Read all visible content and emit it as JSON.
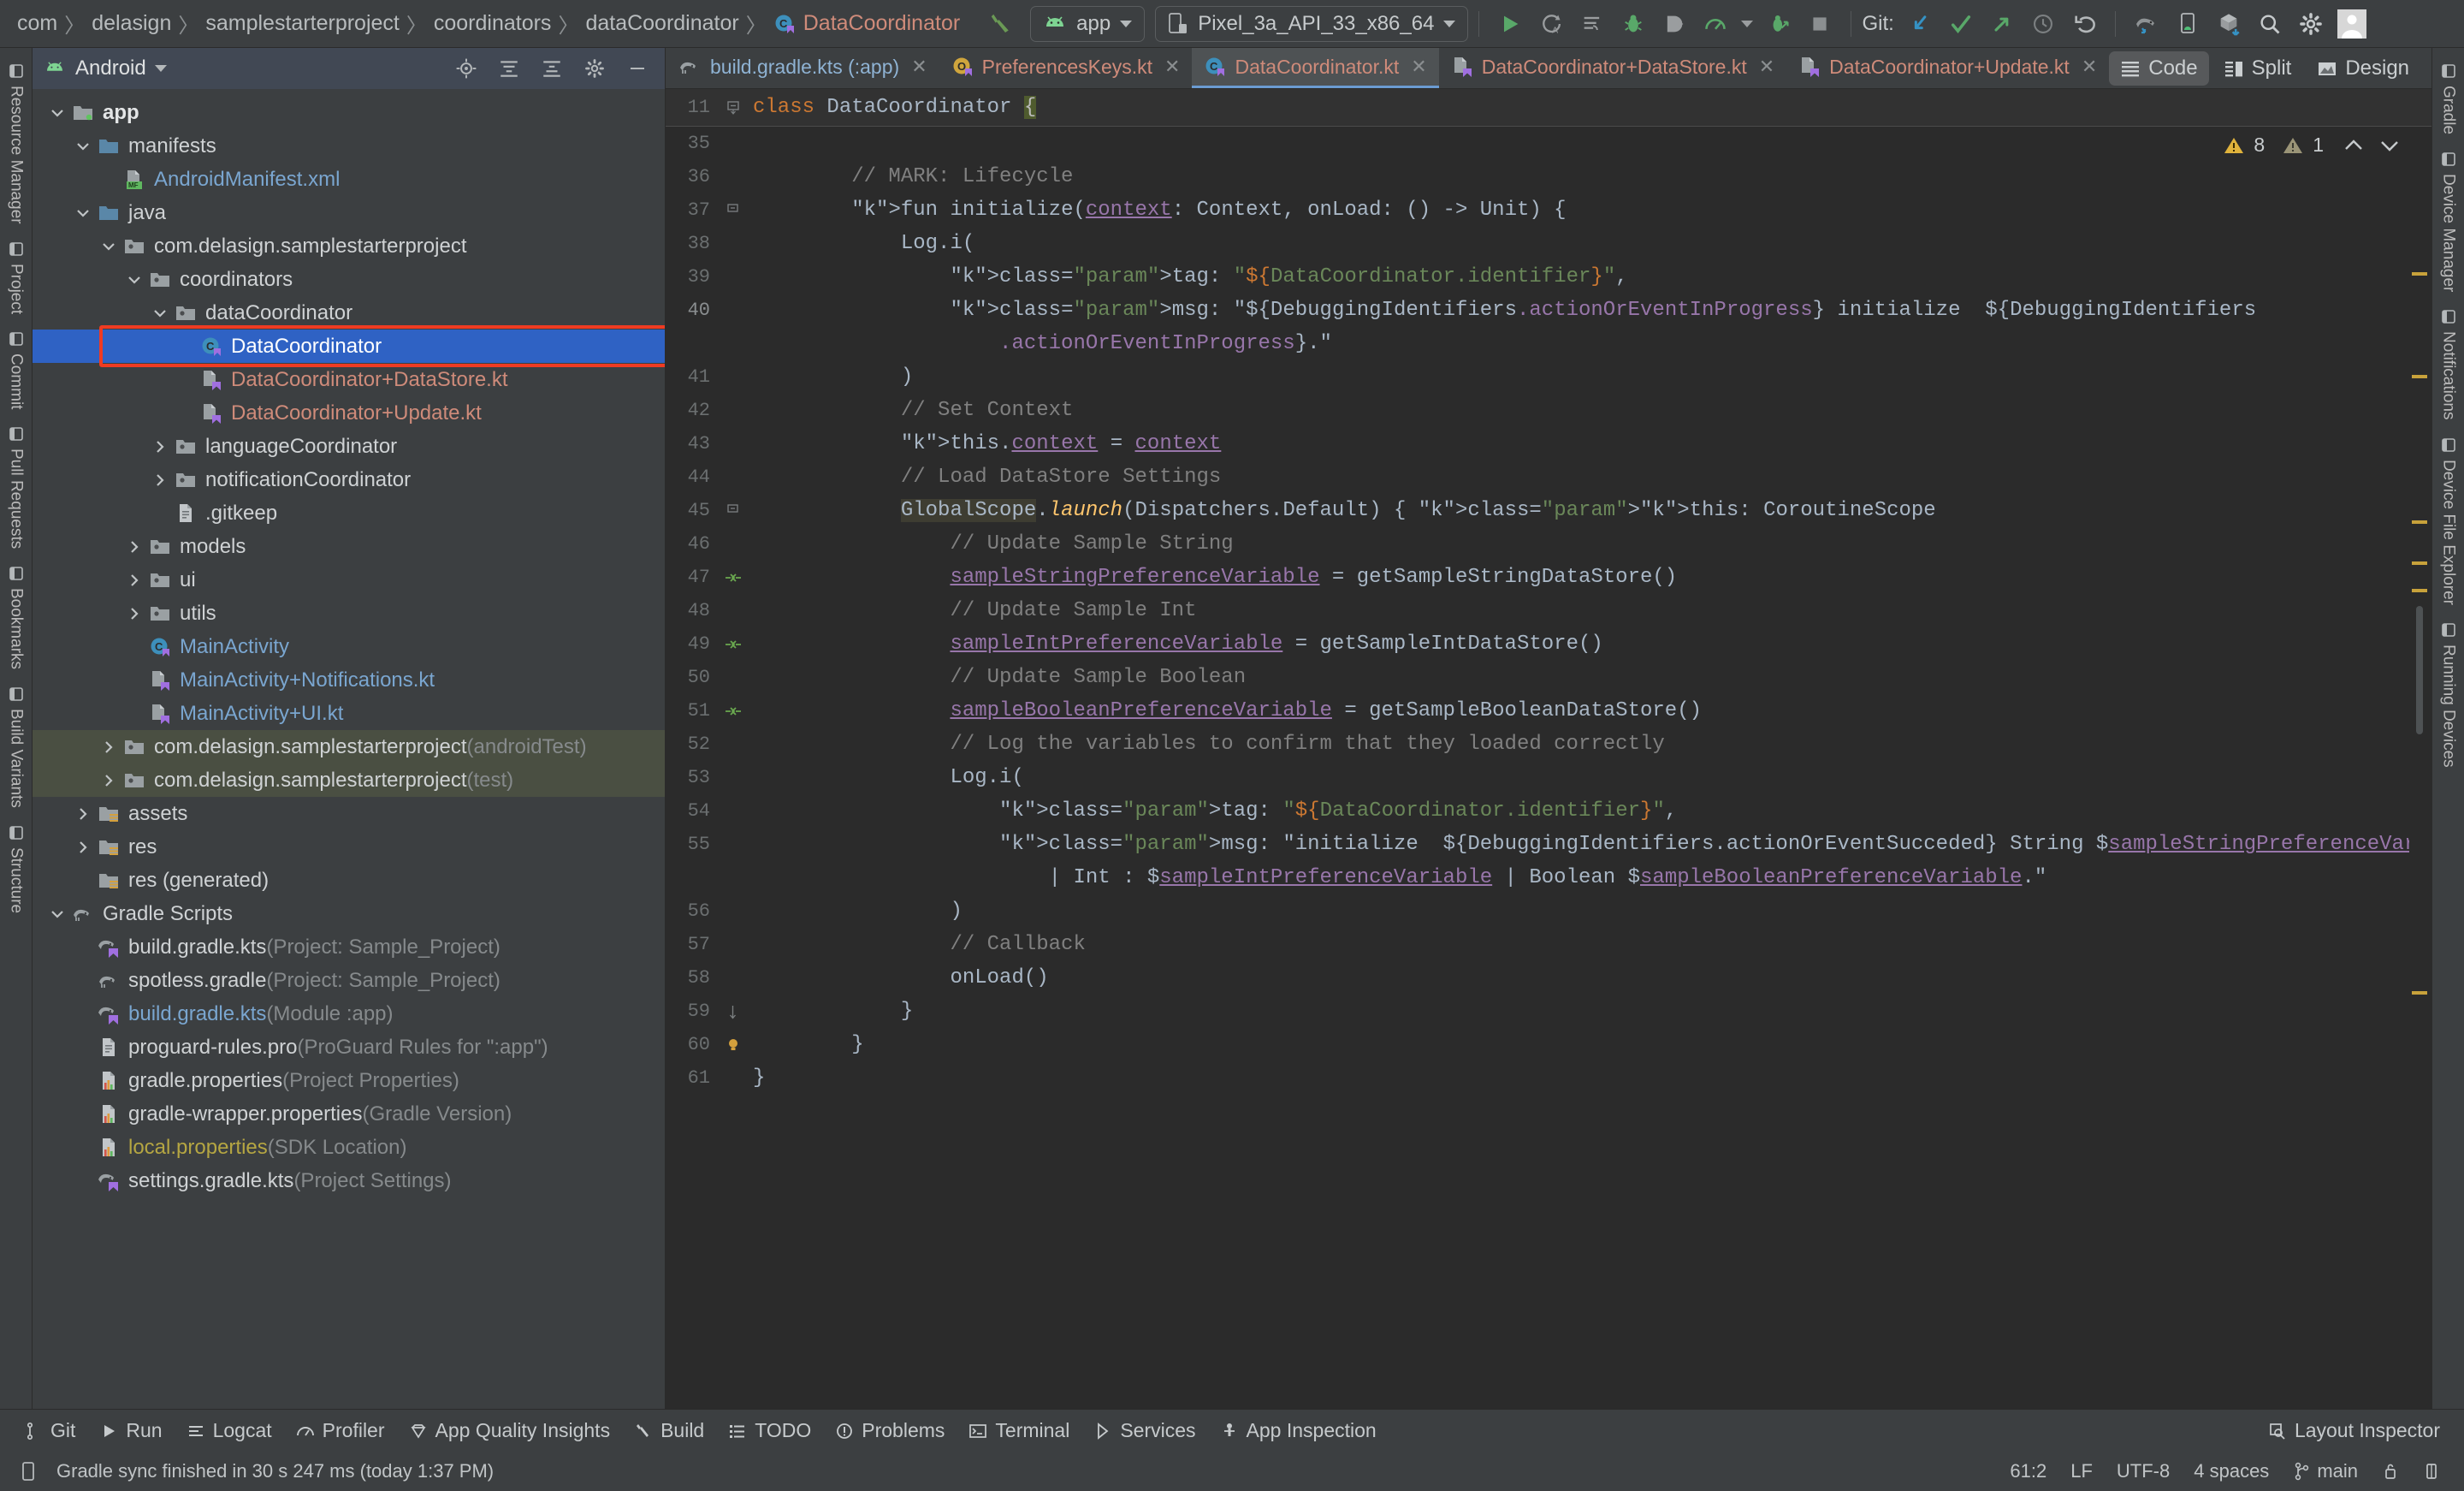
{
  "toolbar": {
    "breadcrumbs": [
      {
        "label": "com",
        "kind": "plain"
      },
      {
        "label": "delasign",
        "kind": "plain"
      },
      {
        "label": "samplestarterproject",
        "kind": "plain"
      },
      {
        "label": "coordinators",
        "kind": "plain"
      },
      {
        "label": "dataCoordinator",
        "kind": "plain"
      },
      {
        "label": "DataCoordinator",
        "kind": "kotlin-class"
      }
    ],
    "build_icon": "hammer-icon",
    "run_config": {
      "label": "app",
      "icon": "android-icon"
    },
    "device": {
      "label": "Pixel_3a_API_33_x86_64",
      "icon": "device-icon"
    },
    "actions": [
      {
        "name": "run-button",
        "icon": "play-icon"
      },
      {
        "name": "apply-changes-button",
        "icon": "apply-changes-icon"
      },
      {
        "name": "apply-code-changes-button",
        "icon": "apply-code-changes-icon"
      },
      {
        "name": "debug-button",
        "icon": "debug-icon"
      },
      {
        "name": "attach-debugger-button",
        "icon": "attach-debugger-icon"
      },
      {
        "name": "profiler-button",
        "icon": "profiler-icon"
      },
      {
        "name": "profiler-dropdown",
        "icon": "chevron-down-icon"
      },
      {
        "name": "run-with-coverage-button",
        "icon": "coverage-icon"
      },
      {
        "name": "stop-button",
        "icon": "stop-icon"
      }
    ],
    "git_label": "Git:",
    "git_actions": [
      {
        "name": "git-update-button",
        "icon": "update-project-icon"
      },
      {
        "name": "git-commit-button",
        "icon": "commit-check-icon"
      },
      {
        "name": "git-push-button",
        "icon": "push-arrow-icon"
      },
      {
        "name": "git-history-button",
        "icon": "history-clock-icon"
      },
      {
        "name": "git-rollback-button",
        "icon": "undo-icon"
      }
    ],
    "right_actions": [
      {
        "name": "gradle-sync-button",
        "icon": "gradle-sync-icon"
      },
      {
        "name": "device-manager-button",
        "icon": "device-manager-icon"
      },
      {
        "name": "sdk-manager-button",
        "icon": "sdk-manager-icon"
      },
      {
        "name": "search-button",
        "icon": "search-icon"
      },
      {
        "name": "settings-button",
        "icon": "gear-icon"
      },
      {
        "name": "account-button",
        "icon": "avatar-icon"
      }
    ]
  },
  "left_rail": [
    {
      "label": "Resource Manager",
      "icon": "resource-manager-icon"
    },
    {
      "label": "Project",
      "icon": "project-icon"
    },
    {
      "label": "Commit",
      "icon": "commit-icon"
    },
    {
      "label": "Pull Requests",
      "icon": "pull-requests-icon"
    },
    {
      "label": "Bookmarks",
      "icon": "bookmarks-icon"
    },
    {
      "label": "Build Variants",
      "icon": "build-variants-icon"
    },
    {
      "label": "Structure",
      "icon": "structure-icon"
    }
  ],
  "right_rail": [
    {
      "label": "Gradle",
      "icon": "gradle-icon"
    },
    {
      "label": "Device Manager",
      "icon": "device-manager-icon"
    },
    {
      "label": "Notifications",
      "icon": "bell-icon"
    },
    {
      "label": "Device File Explorer",
      "icon": "device-file-explorer-icon"
    },
    {
      "label": "Running Devices",
      "icon": "running-devices-icon"
    }
  ],
  "project_panel": {
    "title": "Android",
    "dropdown_icon": "chevron-down-icon",
    "header_actions": [
      {
        "name": "select-opened-file-button",
        "icon": "target-icon"
      },
      {
        "name": "expand-all-button",
        "icon": "expand-all-icon"
      },
      {
        "name": "collapse-all-button",
        "icon": "collapse-all-icon"
      },
      {
        "name": "settings-button",
        "icon": "gear-icon"
      },
      {
        "name": "hide-button",
        "icon": "minimize-icon"
      }
    ],
    "tree": [
      {
        "depth": 0,
        "twisty": "down",
        "icon": "module-folder",
        "label": "app",
        "style": "bold"
      },
      {
        "depth": 1,
        "twisty": "down",
        "icon": "folder-blue",
        "label": "manifests",
        "style": "plain"
      },
      {
        "depth": 2,
        "twisty": "none",
        "icon": "manifest-file",
        "label": "AndroidManifest.xml",
        "style": "blue"
      },
      {
        "depth": 1,
        "twisty": "down",
        "icon": "folder-blue",
        "label": "java",
        "style": "plain"
      },
      {
        "depth": 2,
        "twisty": "down",
        "icon": "package-folder",
        "label": "com.delasign.samplestarterproject",
        "style": "plain"
      },
      {
        "depth": 3,
        "twisty": "down",
        "icon": "package-folder",
        "label": "coordinators",
        "style": "plain"
      },
      {
        "depth": 4,
        "twisty": "down",
        "icon": "package-folder",
        "label": "dataCoordinator",
        "style": "plain"
      },
      {
        "depth": 5,
        "twisty": "none",
        "icon": "kotlin-class",
        "label": "DataCoordinator",
        "style": "plain",
        "selected": true,
        "highlighted": true
      },
      {
        "depth": 5,
        "twisty": "none",
        "icon": "kotlin-file",
        "label": "DataCoordinator+DataStore.kt",
        "style": "red"
      },
      {
        "depth": 5,
        "twisty": "none",
        "icon": "kotlin-file",
        "label": "DataCoordinator+Update.kt",
        "style": "red"
      },
      {
        "depth": 4,
        "twisty": "right",
        "icon": "package-folder",
        "label": "languageCoordinator",
        "style": "plain"
      },
      {
        "depth": 4,
        "twisty": "right",
        "icon": "package-folder",
        "label": "notificationCoordinator",
        "style": "plain"
      },
      {
        "depth": 4,
        "twisty": "none",
        "icon": "text-file",
        "label": ".gitkeep",
        "style": "plain"
      },
      {
        "depth": 3,
        "twisty": "right",
        "icon": "package-folder",
        "label": "models",
        "style": "plain"
      },
      {
        "depth": 3,
        "twisty": "right",
        "icon": "package-folder",
        "label": "ui",
        "style": "plain"
      },
      {
        "depth": 3,
        "twisty": "right",
        "icon": "package-folder",
        "label": "utils",
        "style": "plain"
      },
      {
        "depth": 3,
        "twisty": "none",
        "icon": "kotlin-class",
        "label": "MainActivity",
        "style": "blue"
      },
      {
        "depth": 3,
        "twisty": "none",
        "icon": "kotlin-file",
        "label": "MainActivity+Notifications.kt",
        "style": "blue"
      },
      {
        "depth": 3,
        "twisty": "none",
        "icon": "kotlin-file",
        "label": "MainActivity+UI.kt",
        "style": "blue"
      },
      {
        "depth": 2,
        "twisty": "right",
        "icon": "package-folder",
        "label": "com.delasign.samplestarterproject",
        "suffix": "(androidTest)",
        "style": "plain",
        "testgroup": true
      },
      {
        "depth": 2,
        "twisty": "right",
        "icon": "package-folder",
        "label": "com.delasign.samplestarterproject",
        "suffix": "(test)",
        "style": "plain",
        "testgroup": true
      },
      {
        "depth": 1,
        "twisty": "right",
        "icon": "res-folder",
        "label": "assets",
        "style": "plain"
      },
      {
        "depth": 1,
        "twisty": "right",
        "icon": "res-folder",
        "label": "res",
        "style": "plain"
      },
      {
        "depth": 1,
        "twisty": "none",
        "icon": "res-folder",
        "label": "res (generated)",
        "style": "plain"
      },
      {
        "depth": 0,
        "twisty": "down",
        "icon": "gradle-elephant",
        "label": "Gradle Scripts",
        "style": "plain"
      },
      {
        "depth": 1,
        "twisty": "none",
        "icon": "gradle-kts",
        "label": "build.gradle.kts",
        "suffix": "(Project: Sample_Project)",
        "style": "plain"
      },
      {
        "depth": 1,
        "twisty": "none",
        "icon": "gradle-elephant",
        "label": "spotless.gradle",
        "suffix": "(Project: Sample_Project)",
        "style": "plain"
      },
      {
        "depth": 1,
        "twisty": "none",
        "icon": "gradle-kts",
        "label": "build.gradle.kts",
        "suffix": "(Module :app)",
        "style": "blue"
      },
      {
        "depth": 1,
        "twisty": "none",
        "icon": "text-file",
        "label": "proguard-rules.pro",
        "suffix": "(ProGuard Rules for \":app\")",
        "style": "plain"
      },
      {
        "depth": 1,
        "twisty": "none",
        "icon": "properties-file",
        "label": "gradle.properties",
        "suffix": "(Project Properties)",
        "style": "plain"
      },
      {
        "depth": 1,
        "twisty": "none",
        "icon": "properties-file",
        "label": "gradle-wrapper.properties",
        "suffix": "(Gradle Version)",
        "style": "plain"
      },
      {
        "depth": 1,
        "twisty": "none",
        "icon": "properties-file",
        "label": "local.properties",
        "suffix": "(SDK Location)",
        "style": "yellow"
      },
      {
        "depth": 1,
        "twisty": "none",
        "icon": "gradle-kts",
        "label": "settings.gradle.kts",
        "suffix": "(Project Settings)",
        "style": "plain"
      }
    ]
  },
  "editor": {
    "tabs": [
      {
        "label": "build.gradle.kts (:app)",
        "icon": "gradle-elephant",
        "style": "blue",
        "active": false
      },
      {
        "label": "PreferencesKeys.kt",
        "icon": "kotlin-object",
        "style": "red",
        "active": false
      },
      {
        "label": "DataCoordinator.kt",
        "icon": "kotlin-class",
        "style": "red",
        "active": true
      },
      {
        "label": "DataCoordinator+DataStore.kt",
        "icon": "kotlin-file",
        "style": "red",
        "active": false
      },
      {
        "label": "DataCoordinator+Update.kt",
        "icon": "kotlin-file",
        "style": "red",
        "active": false
      }
    ],
    "more_icon": "more-vertical-icon",
    "view_modes": [
      {
        "label": "Code",
        "icon": "code-icon",
        "active": true
      },
      {
        "label": "Split",
        "icon": "split-icon",
        "active": false
      },
      {
        "label": "Design",
        "icon": "design-icon",
        "active": false
      }
    ],
    "sticky_line": {
      "number": "11",
      "text": "class DataCoordinator {"
    },
    "inspections": {
      "warning_count": "8",
      "weak_warning_count": "1",
      "up_icon": "chevron-up-icon",
      "down_icon": "chevron-down-icon"
    },
    "lines": [
      {
        "n": "35",
        "text": ""
      },
      {
        "n": "36",
        "text": "        // MARK: Lifecycle"
      },
      {
        "n": "37",
        "text": "        fun initialize(context: Context, onLoad: () -> Unit) {"
      },
      {
        "n": "38",
        "text": "            Log.i("
      },
      {
        "n": "39",
        "text": "                tag: \"${DataCoordinator.identifier}\","
      },
      {
        "n": "40",
        "text": "                msg: \"${DebuggingIdentifiers.actionOrEventInProgress} initialize  ${DebuggingIdentifiers"
      },
      {
        "n": "",
        "text": "                    .actionOrEventInProgress}.\""
      },
      {
        "n": "41",
        "text": "            )"
      },
      {
        "n": "42",
        "text": "            // Set Context"
      },
      {
        "n": "43",
        "text": "            this.context = context"
      },
      {
        "n": "44",
        "text": "            // Load DataStore Settings"
      },
      {
        "n": "45",
        "text": "            GlobalScope.launch(Dispatchers.Default) { this: CoroutineScope"
      },
      {
        "n": "46",
        "text": "                // Update Sample String"
      },
      {
        "n": "47",
        "text": "                sampleStringPreferenceVariable = getSampleStringDataStore()"
      },
      {
        "n": "48",
        "text": "                // Update Sample Int"
      },
      {
        "n": "49",
        "text": "                sampleIntPreferenceVariable = getSampleIntDataStore()"
      },
      {
        "n": "50",
        "text": "                // Update Sample Boolean"
      },
      {
        "n": "51",
        "text": "                sampleBooleanPreferenceVariable = getSampleBooleanDataStore()"
      },
      {
        "n": "52",
        "text": "                // Log the variables to confirm that they loaded correctly"
      },
      {
        "n": "53",
        "text": "                Log.i("
      },
      {
        "n": "54",
        "text": "                    tag: \"${DataCoordinator.identifier}\","
      },
      {
        "n": "55",
        "text": "                    msg: \"initialize  ${DebuggingIdentifiers.actionOrEventSucceded} String $sampleStringPreferenceVariable"
      },
      {
        "n": "",
        "text": "                        | Int : $sampleIntPreferenceVariable | Boolean $sampleBooleanPreferenceVariable.\""
      },
      {
        "n": "56",
        "text": "                )"
      },
      {
        "n": "57",
        "text": "                // Callback"
      },
      {
        "n": "58",
        "text": "                onLoad()"
      },
      {
        "n": "59",
        "text": "            }"
      },
      {
        "n": "60",
        "text": "        }"
      },
      {
        "n": "61",
        "text": "}"
      }
    ]
  },
  "bottom_bar": {
    "items": [
      {
        "label": "Git",
        "icon": "git-branch-icon"
      },
      {
        "label": "Run",
        "icon": "play-icon"
      },
      {
        "label": "Logcat",
        "icon": "logcat-icon"
      },
      {
        "label": "Profiler",
        "icon": "profiler-icon"
      },
      {
        "label": "App Quality Insights",
        "icon": "quality-insights-icon"
      },
      {
        "label": "Build",
        "icon": "hammer-icon"
      },
      {
        "label": "TODO",
        "icon": "todo-icon"
      },
      {
        "label": "Problems",
        "icon": "problems-icon"
      },
      {
        "label": "Terminal",
        "icon": "terminal-icon"
      },
      {
        "label": "Services",
        "icon": "services-icon"
      },
      {
        "label": "App Inspection",
        "icon": "app-inspection-icon"
      }
    ],
    "right": {
      "label": "Layout Inspector",
      "icon": "layout-inspector-icon"
    }
  },
  "status_bar": {
    "icon": "status-event-icon",
    "message": "Gradle sync finished in 30 s 247 ms (today 1:37 PM)",
    "caret": "61:2",
    "line_separator": "LF",
    "encoding": "UTF-8",
    "indent": "4 spaces",
    "branch": "main",
    "branch_icon": "git-branch-icon",
    "lock_icon": "lock-icon",
    "inspection_icon": "inspection-icon"
  },
  "colors": {
    "accent_blue": "#2f62c4",
    "highlight_red": "#ef3b22",
    "kotlin_red": "#cf8b7a",
    "link_blue": "#7aa6d0",
    "editor_bg": "#2b2b2b",
    "panel_bg": "#3c3f41"
  }
}
